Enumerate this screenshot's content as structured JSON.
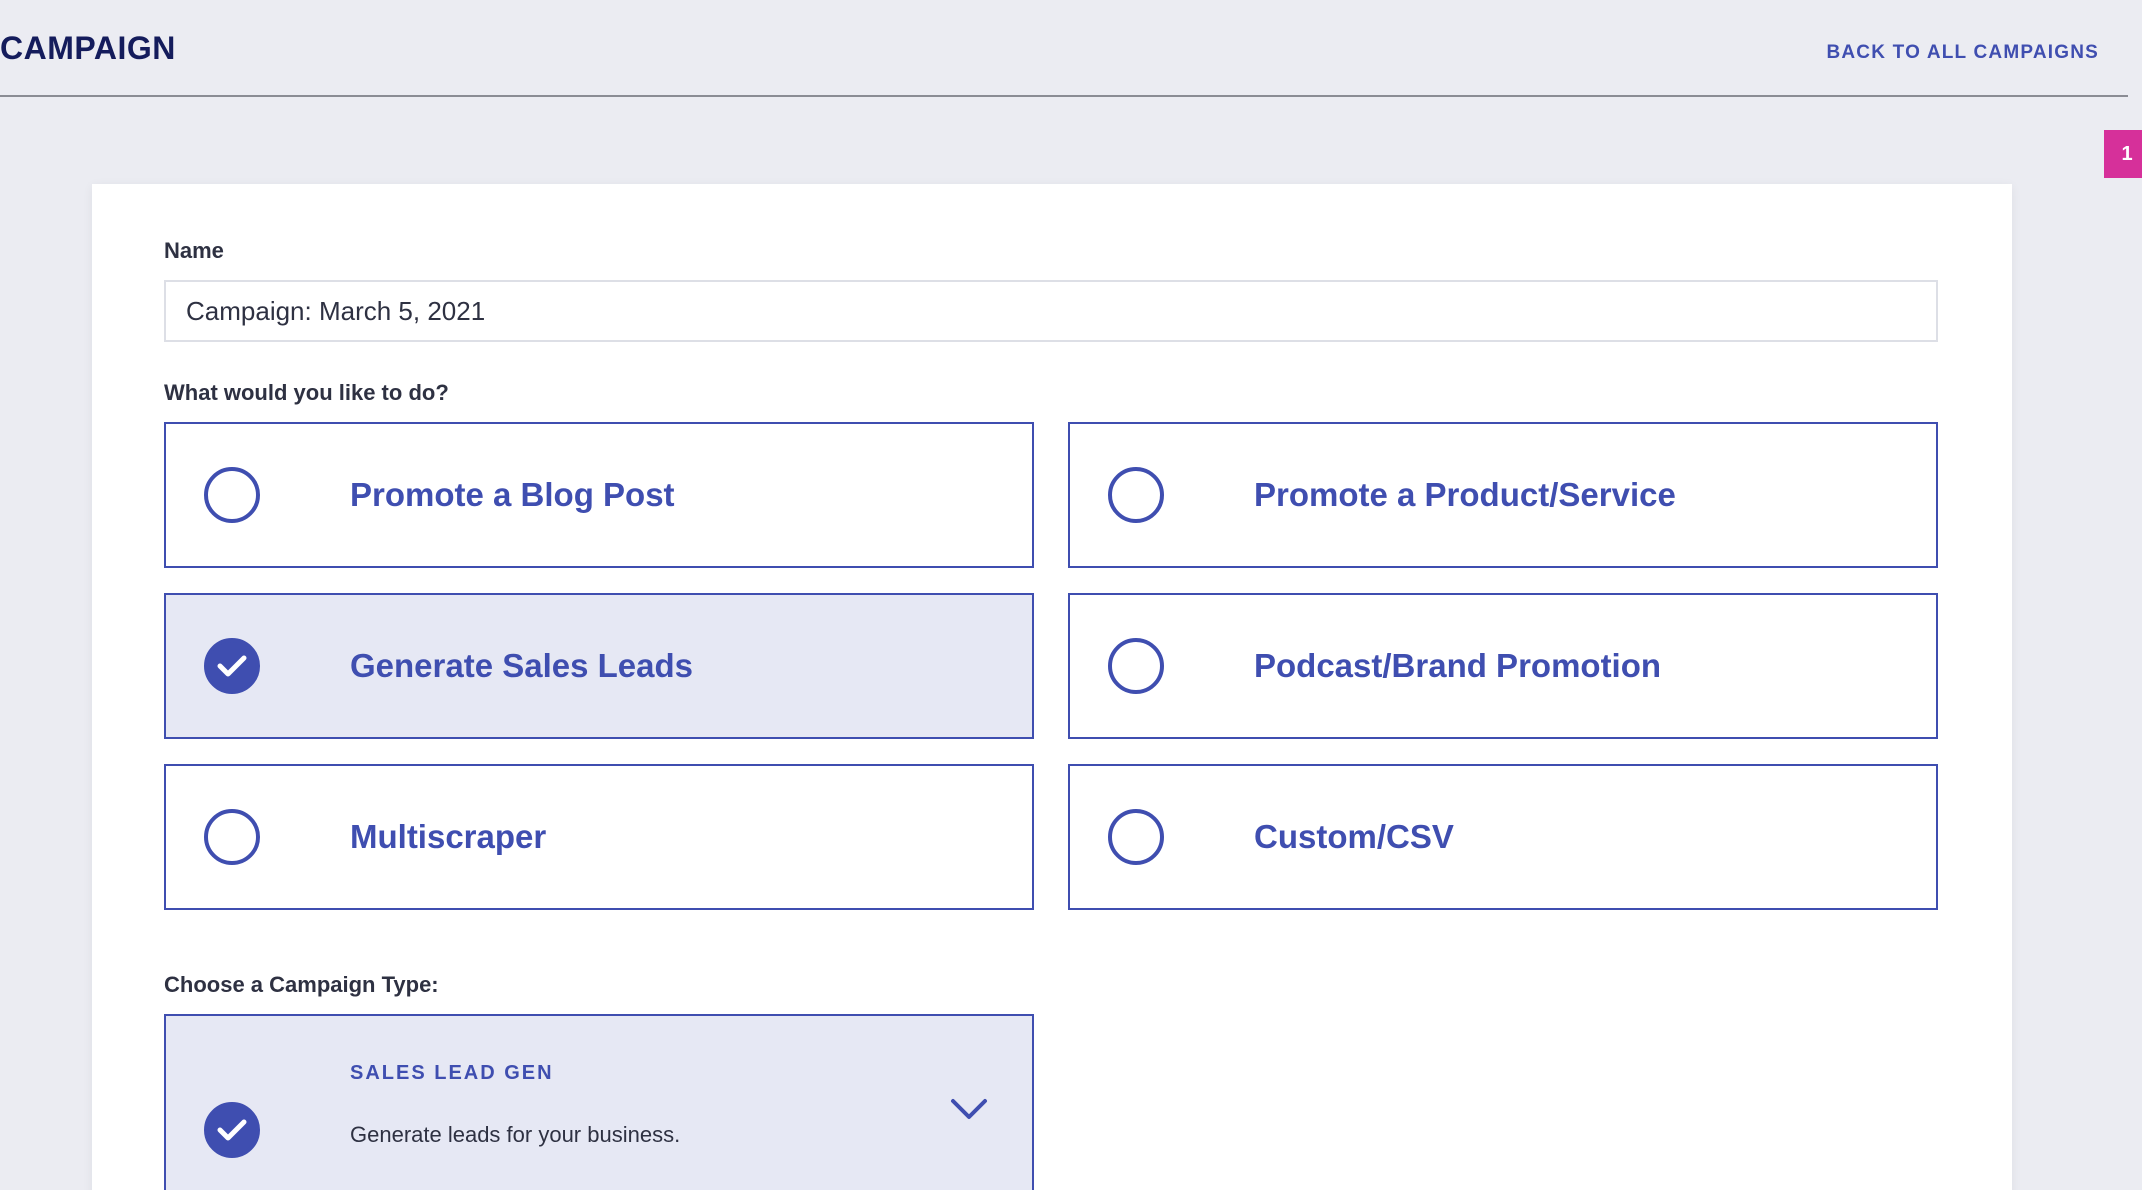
{
  "header": {
    "title": "CAMPAIGN",
    "back_link": "BACK TO ALL CAMPAIGNS",
    "badge": "1"
  },
  "form": {
    "name_label": "Name",
    "name_value": "Campaign: March 5, 2021",
    "goal_label": "What would you like to do?",
    "options": [
      {
        "label": "Promote a Blog Post",
        "selected": false
      },
      {
        "label": "Promote a Product/Service",
        "selected": false
      },
      {
        "label": "Generate Sales Leads",
        "selected": true
      },
      {
        "label": "Podcast/Brand Promotion",
        "selected": false
      },
      {
        "label": "Multiscraper",
        "selected": false
      },
      {
        "label": "Custom/CSV",
        "selected": false
      }
    ],
    "type_label": "Choose a Campaign Type:",
    "campaign_type": {
      "title": "SALES LEAD GEN",
      "description": "Generate leads for your business.",
      "selected": true
    }
  },
  "colors": {
    "accent": "#3f4eb0",
    "title": "#141c5c",
    "badge": "#d6309a",
    "selected_bg": "#e6e8f4",
    "page_bg": "#ebecf2"
  },
  "icons": {
    "checked": "check-circle-icon",
    "unchecked": "empty-circle-icon",
    "dropdown": "chevron-down-icon"
  }
}
